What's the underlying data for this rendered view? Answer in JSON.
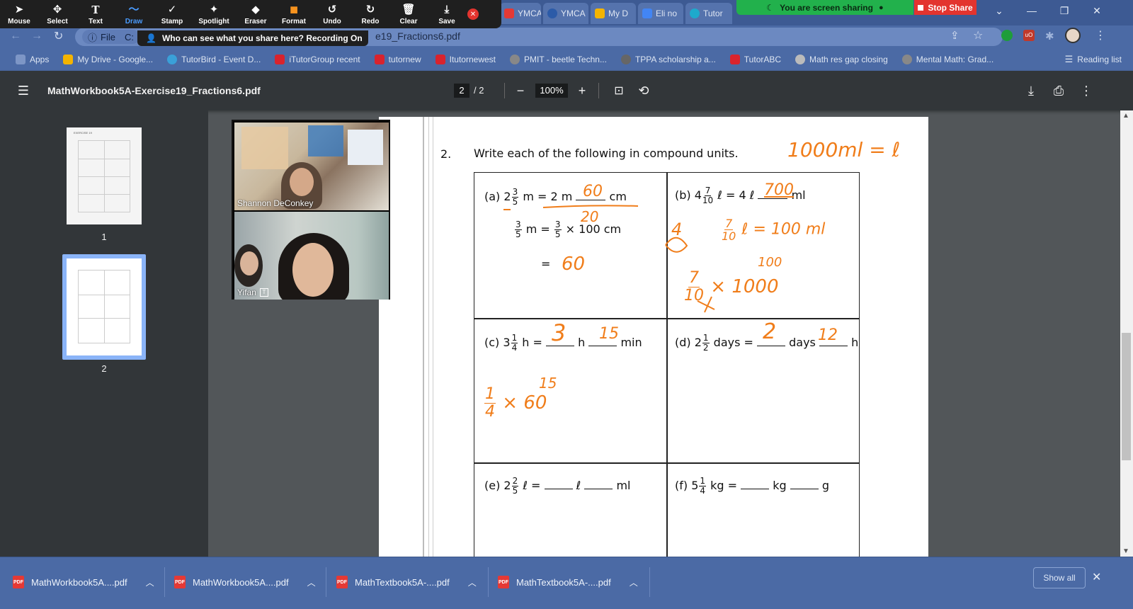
{
  "zoom_toolbar": {
    "tools": [
      {
        "label": "Mouse",
        "icon": "cursor-icon",
        "glyph": "➤"
      },
      {
        "label": "Select",
        "icon": "move-icon",
        "glyph": "✥"
      },
      {
        "label": "Text",
        "icon": "text-icon",
        "glyph": "T"
      },
      {
        "label": "Draw",
        "icon": "draw-icon",
        "glyph": "〜"
      },
      {
        "label": "Stamp",
        "icon": "stamp-icon",
        "glyph": "✓"
      },
      {
        "label": "Spotlight",
        "icon": "spotlight-icon",
        "glyph": "✦"
      },
      {
        "label": "Eraser",
        "icon": "eraser-icon",
        "glyph": "◆"
      },
      {
        "label": "Format",
        "icon": "format-icon",
        "glyph": "■"
      },
      {
        "label": "Undo",
        "icon": "undo-icon",
        "glyph": "↺"
      },
      {
        "label": "Redo",
        "icon": "redo-icon",
        "glyph": "↻"
      },
      {
        "label": "Clear",
        "icon": "trash-icon",
        "glyph": "🗑"
      },
      {
        "label": "Save",
        "icon": "save-icon",
        "glyph": "⤓"
      }
    ],
    "active_tool": "Draw",
    "format_color": "#f7931e"
  },
  "screen_share": {
    "status": "You are screen sharing",
    "stop_label": "Stop Share",
    "who_can_see": "Who can see what you share here? Recording On"
  },
  "browser": {
    "tabs": [
      "YMCA",
      "YMCA",
      "My D",
      "Eli no",
      "Tutor"
    ],
    "address_url": "e19_Fractions6.pdf",
    "file_chip": "File",
    "file_chip_extra": "C:",
    "bookmarks": [
      {
        "label": "Apps",
        "color": "#7d96c6"
      },
      {
        "label": "My Drive - Google...",
        "color": "#f4b400"
      },
      {
        "label": "TutorBird - Event D...",
        "color": "#3aa0d8"
      },
      {
        "label": "iTutorGroup recent",
        "color": "#d9232d"
      },
      {
        "label": "tutornew",
        "color": "#d9232d"
      },
      {
        "label": "Itutornewest",
        "color": "#d9232d"
      },
      {
        "label": "PMIT - beetle Techn...",
        "color": "#888"
      },
      {
        "label": "TPPA scholarship a...",
        "color": "#666"
      },
      {
        "label": "TutorABC",
        "color": "#d9232d"
      },
      {
        "label": "Math res gap closing",
        "color": "#bbb"
      },
      {
        "label": "Mental Math: Grad...",
        "color": "#888"
      }
    ],
    "reading_list": "Reading list"
  },
  "pdf_viewer": {
    "filename": "MathWorkbook5A-Exercise19_Fractions6.pdf",
    "current_page": "2",
    "total_pages": "/ 2",
    "zoom": "100%",
    "thumbnails": [
      {
        "number": "1",
        "selected": false,
        "heading": "EXERCISE 19",
        "lines": 4
      },
      {
        "number": "2",
        "selected": true,
        "lines": 3
      }
    ]
  },
  "participants": [
    {
      "name": "Shannon DeConkey"
    },
    {
      "name": "Yifan"
    }
  ],
  "worksheet": {
    "question_number": "2.",
    "instruction": "Write each of the following in compound units.",
    "items": [
      {
        "label": "(a)",
        "whole": "2",
        "num": "3",
        "den": "5",
        "unit1": "m =",
        "value1": "2 m",
        "unit2": "cm"
      },
      {
        "label": "(b)",
        "whole": "4",
        "num": "7",
        "den": "10",
        "unit1": "ℓ =",
        "value1": "4 ℓ",
        "unit2": "ml"
      },
      {
        "label": "(c)",
        "whole": "3",
        "num": "1",
        "den": "4",
        "unit1": "h =",
        "value1": "",
        "mid": "h",
        "unit2": "min"
      },
      {
        "label": "(d)",
        "whole": "2",
        "num": "1",
        "den": "2",
        "unit1": "days =",
        "value1": "",
        "mid": "days",
        "unit2": "h"
      },
      {
        "label": "(e)",
        "whole": "2",
        "num": "2",
        "den": "5",
        "unit1": "ℓ =",
        "value1": "",
        "mid": "ℓ",
        "unit2": "ml"
      },
      {
        "label": "(f)",
        "whole": "5",
        "num": "1",
        "den": "4",
        "unit1": "kg =",
        "value1": "",
        "mid": "kg",
        "unit2": "g"
      }
    ],
    "working_a": {
      "frac_num": "3",
      "frac_den": "5",
      "unit": "m =",
      "times": "× 100 cm",
      "eq": "="
    },
    "annotations": {
      "a_answer": "60",
      "a_strike": "20",
      "a_result": "60",
      "b_answer": "700",
      "b_note1": "1000ml = ℓ",
      "b_circle": "4",
      "b_note2_num": "7",
      "b_note2_den": "10",
      "b_note2_rest": "ℓ = 100 ml",
      "b_work_num": "7",
      "b_work_den": "10",
      "b_work_times": "× 1000",
      "b_work_small": "100",
      "c_answer1": "3",
      "c_answer2": "15",
      "c_work_num": "1",
      "c_work_den": "4",
      "c_work_times": "× 60",
      "c_work_small": "15",
      "d_answer1": "2",
      "d_answer2": "12"
    }
  },
  "downloads": {
    "items": [
      "MathWorkbook5A....pdf",
      "MathWorkbook5A....pdf",
      "MathTextbook5A-....pdf",
      "MathTextbook5A-....pdf"
    ],
    "pdf_badge": "PDF",
    "show_all": "Show all"
  }
}
